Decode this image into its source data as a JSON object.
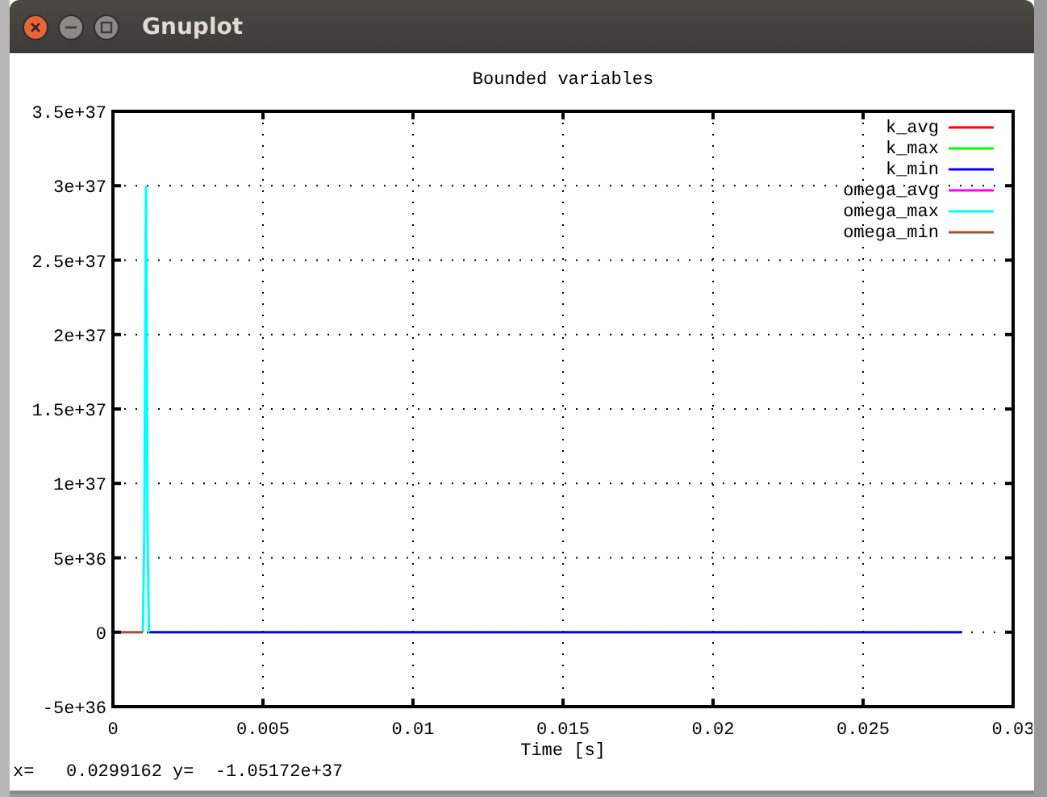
{
  "window": {
    "title": "Gnuplot"
  },
  "plot": {
    "chart_data": {
      "type": "line",
      "title": "Bounded variables",
      "xlabel": "Time [s]",
      "x": [
        0.0002,
        0.001,
        0.00105,
        0.0011,
        0.00115,
        0.0012,
        0.0283
      ],
      "series": [
        {
          "name": "k_avg",
          "color": "#ff0000",
          "values": [
            null,
            null,
            null,
            null,
            null,
            null,
            null
          ]
        },
        {
          "name": "k_max",
          "color": "#00ff00",
          "values": [
            null,
            null,
            null,
            null,
            null,
            null,
            null
          ]
        },
        {
          "name": "k_min",
          "color": "#0000ff",
          "values": [
            null,
            null,
            null,
            null,
            null,
            0,
            0
          ]
        },
        {
          "name": "omega_avg",
          "color": "#ff00ff",
          "values": [
            null,
            null,
            null,
            null,
            null,
            null,
            null
          ]
        },
        {
          "name": "omega_max",
          "color": "#00ffff",
          "values": [
            null,
            0,
            7.5e+36,
            3e+37,
            7.5e+36,
            0,
            null
          ]
        },
        {
          "name": "omega_min",
          "color": "#a0522d",
          "values": [
            0,
            0,
            null,
            null,
            null,
            null,
            null
          ]
        }
      ],
      "grid": true,
      "legend": true,
      "xlim": [
        0,
        0.03
      ],
      "ylim": [
        -5e+36,
        3.5e+37
      ],
      "xticks": [
        {
          "value": 0,
          "label": "0"
        },
        {
          "value": 0.005,
          "label": "0.005"
        },
        {
          "value": 0.01,
          "label": "0.01"
        },
        {
          "value": 0.015,
          "label": "0.015"
        },
        {
          "value": 0.02,
          "label": "0.02"
        },
        {
          "value": 0.025,
          "label": "0.025"
        },
        {
          "value": 0.03,
          "label": "0.03"
        }
      ],
      "yticks": [
        {
          "value": -5e+36,
          "label": "-5e+36"
        },
        {
          "value": 0,
          "label": "0"
        },
        {
          "value": 5e+36,
          "label": "5e+36"
        },
        {
          "value": 1e+37,
          "label": "1e+37"
        },
        {
          "value": 1.5e+37,
          "label": "1.5e+37"
        },
        {
          "value": 2e+37,
          "label": "2e+37"
        },
        {
          "value": 2.5e+37,
          "label": "2.5e+37"
        },
        {
          "value": 3e+37,
          "label": "3e+37"
        },
        {
          "value": 3.5e+37,
          "label": "3.5e+37"
        }
      ]
    }
  },
  "status_bar": "x=   0.0299162 y=  -1.05172e+37"
}
